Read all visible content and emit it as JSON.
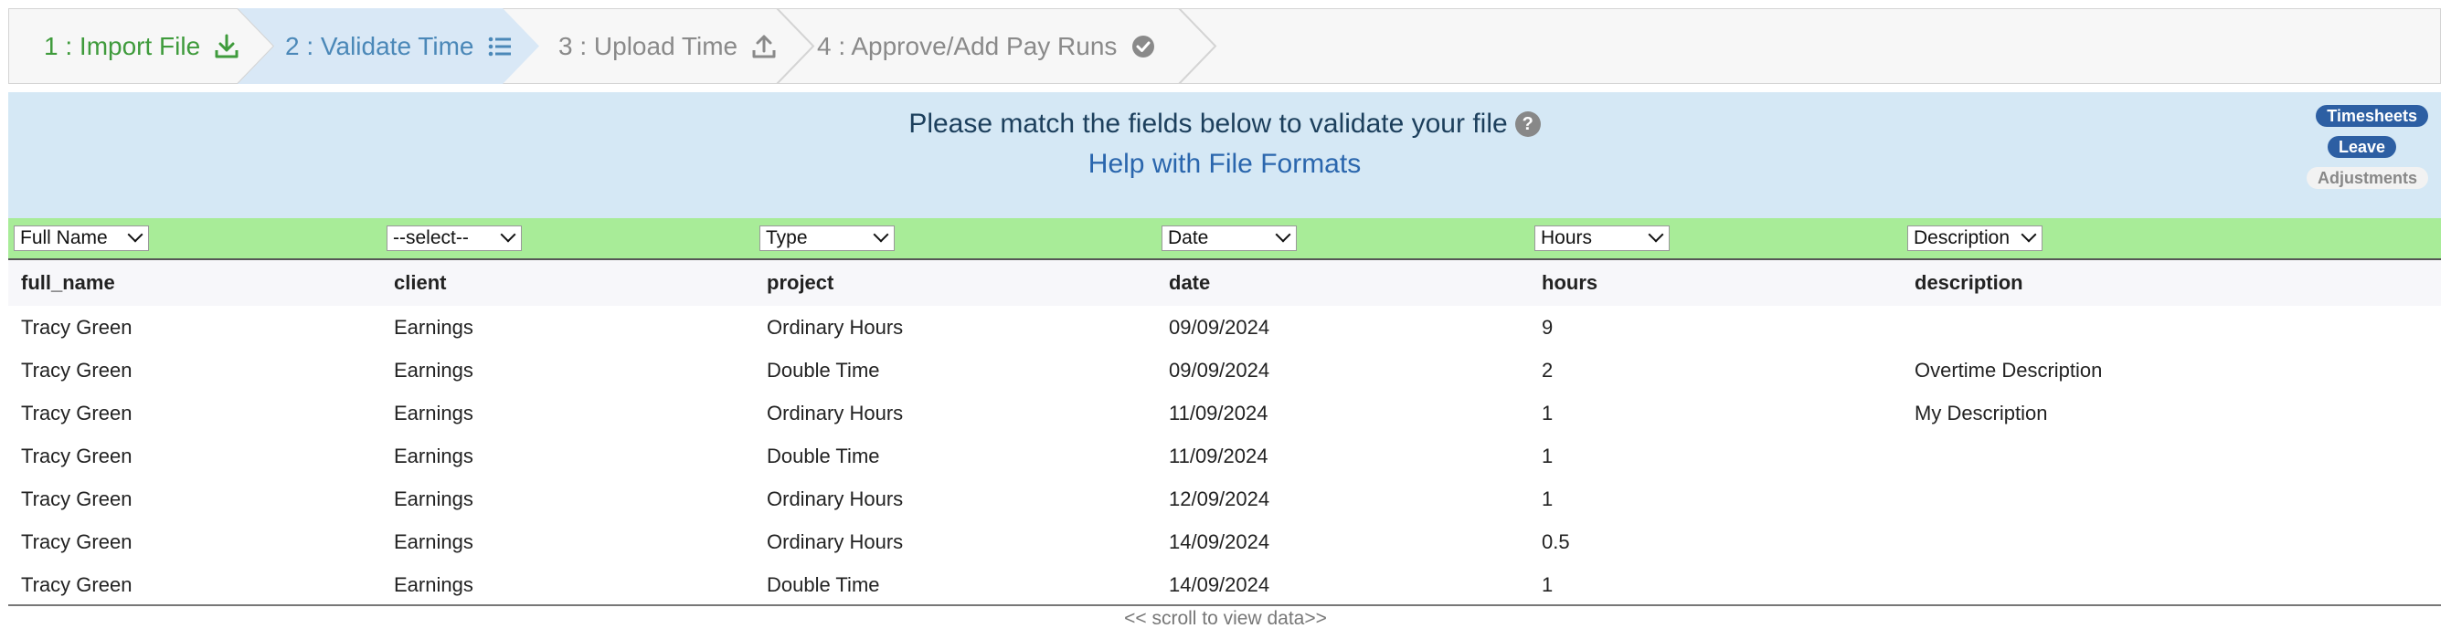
{
  "wizard": {
    "steps": [
      {
        "label": "1 : Import File",
        "icon": "download-icon",
        "color": "#3f9b3c"
      },
      {
        "label": "2 : Validate Time",
        "icon": "list-icon",
        "color": "#4b88b8"
      },
      {
        "label": "3 : Upload Time",
        "icon": "upload-icon",
        "color": "#8a8a8a"
      },
      {
        "label": "4 : Approve/Add Pay Runs",
        "icon": "check-circle-icon",
        "color": "#8a8a8a"
      }
    ]
  },
  "banner": {
    "title": "Please match the fields below to validate your file",
    "help_glyph": "?",
    "link": "Help with File Formats",
    "pills": [
      "Timesheets",
      "Leave",
      "Adjustments"
    ]
  },
  "mapping": [
    "Full Name",
    "--select--",
    "Type",
    "Date",
    "Hours",
    "Description"
  ],
  "table": {
    "columns": [
      "full_name",
      "client",
      "project",
      "date",
      "hours",
      "description"
    ],
    "rows": [
      [
        "Tracy Green",
        "Earnings",
        "Ordinary Hours",
        "09/09/2024",
        "9",
        ""
      ],
      [
        "Tracy Green",
        "Earnings",
        "Double Time",
        "09/09/2024",
        "2",
        "Overtime Description"
      ],
      [
        "Tracy Green",
        "Earnings",
        "Ordinary Hours",
        "11/09/2024",
        "1",
        "My Description"
      ],
      [
        "Tracy Green",
        "Earnings",
        "Double Time",
        "11/09/2024",
        "1",
        ""
      ],
      [
        "Tracy Green",
        "Earnings",
        "Ordinary Hours",
        "12/09/2024",
        "1",
        ""
      ],
      [
        "Tracy Green",
        "Earnings",
        "Ordinary Hours",
        "14/09/2024",
        "0.5",
        ""
      ],
      [
        "Tracy Green",
        "Earnings",
        "Double Time",
        "14/09/2024",
        "1",
        ""
      ]
    ]
  },
  "scroll_hint": "<< scroll to view data>>"
}
